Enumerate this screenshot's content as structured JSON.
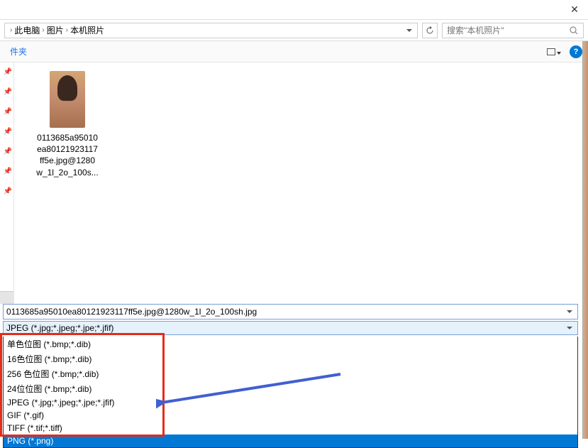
{
  "breadcrumb": {
    "items": [
      "此电脑",
      "图片",
      "本机照片"
    ]
  },
  "search": {
    "placeholder": "搜索\"本机照片\""
  },
  "toolbar": {
    "folder_label": "件夹",
    "help_symbol": "?"
  },
  "file": {
    "name_lines": [
      "0113685a95010",
      "ea80121923117",
      "ff5e.jpg@1280",
      "w_1l_2o_100s..."
    ]
  },
  "filename_field": {
    "value": "0113685a95010ea80121923117ff5e.jpg@1280w_1l_2o_100sh.jpg"
  },
  "filetype_field": {
    "selected": "JPEG (*.jpg;*.jpeg;*.jpe;*.jfif)"
  },
  "dropdown_options": [
    "单色位图 (*.bmp;*.dib)",
    "16色位图 (*.bmp;*.dib)",
    "256 色位图 (*.bmp;*.dib)",
    "24位位图 (*.bmp;*.dib)",
    "JPEG (*.jpg;*.jpeg;*.jpe;*.jfif)",
    "GIF (*.gif)",
    "TIFF (*.tif;*.tiff)",
    "PNG (*.png)"
  ],
  "dropdown_selected_index": 7
}
